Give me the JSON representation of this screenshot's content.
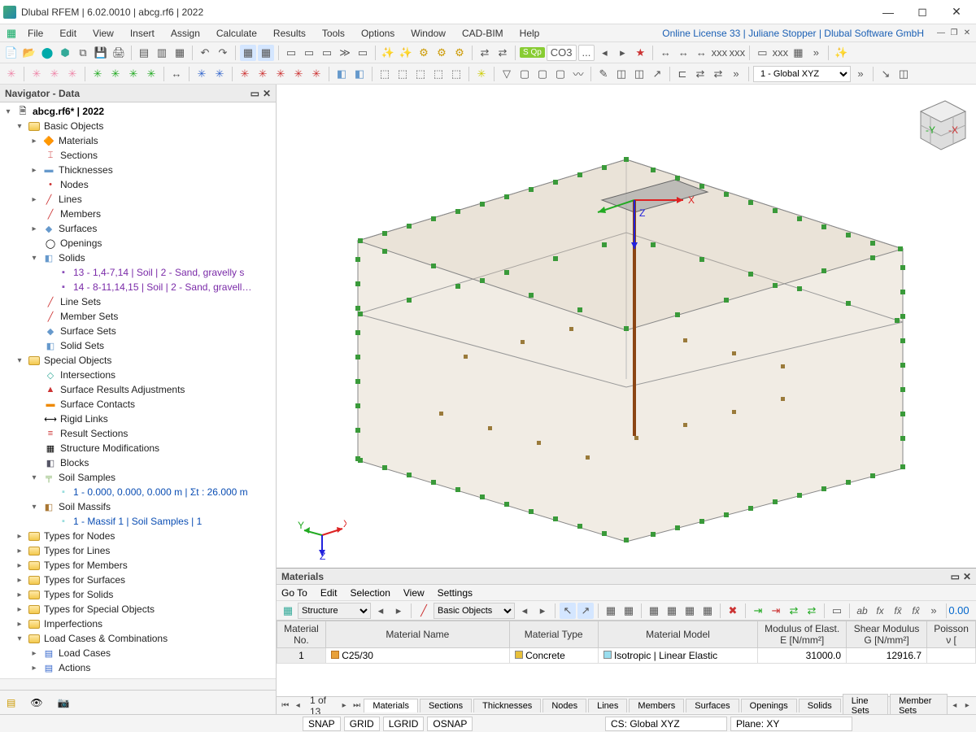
{
  "window": {
    "title": "Dlubal RFEM | 6.02.0010 | abcg.rf6 | 2022"
  },
  "license": "Online License 33 | Juliane Stopper | Dlubal Software GmbH",
  "menu": [
    "File",
    "Edit",
    "View",
    "Insert",
    "Assign",
    "Calculate",
    "Results",
    "Tools",
    "Options",
    "Window",
    "CAD-BIM",
    "Help"
  ],
  "toolbar2": {
    "badge": "S Qp",
    "combo": "CO3",
    "combo_dots": "..."
  },
  "toolbar3": {
    "coord_system": "1 - Global XYZ"
  },
  "navigator": {
    "title": "Navigator - Data",
    "root": "abcg.rf6* | 2022",
    "basic_objects": "Basic Objects",
    "items": {
      "materials": "Materials",
      "sections": "Sections",
      "thicknesses": "Thicknesses",
      "nodes": "Nodes",
      "lines": "Lines",
      "members": "Members",
      "surfaces": "Surfaces",
      "openings": "Openings",
      "solids": "Solids",
      "solid_13": "13 - 1,4-7,14 | Soil | 2 - Sand, gravelly s",
      "solid_14": "14 - 8-11,14,15 | Soil | 2 - Sand, gravell…",
      "line_sets": "Line Sets",
      "member_sets": "Member Sets",
      "surface_sets": "Surface Sets",
      "solid_sets": "Solid Sets"
    },
    "special_objects": "Special Objects",
    "special": {
      "intersections": "Intersections",
      "surface_results_adj": "Surface Results Adjustments",
      "surface_contacts": "Surface Contacts",
      "rigid_links": "Rigid Links",
      "result_sections": "Result Sections",
      "structure_mods": "Structure Modifications",
      "blocks": "Blocks",
      "soil_samples": "Soil Samples",
      "soil_sample_1": "1 - 0.000, 0.000, 0.000 m | Σt : 26.000 m",
      "soil_massifs": "Soil Massifs",
      "soil_massif_1": "1 - Massif 1 | Soil Samples | 1"
    },
    "types": {
      "nodes": "Types for Nodes",
      "lines": "Types for Lines",
      "members": "Types for Members",
      "surfaces": "Types for Surfaces",
      "solids": "Types for Solids",
      "special": "Types for Special Objects",
      "imperfections": "Imperfections",
      "load_cases": "Load Cases & Combinations",
      "lc": "Load Cases",
      "actions": "Actions"
    }
  },
  "materials": {
    "title": "Materials",
    "menu": [
      "Go To",
      "Edit",
      "Selection",
      "View",
      "Settings"
    ],
    "structure_select": "Structure",
    "basic_select": "Basic Objects",
    "headers": [
      "Material No.",
      "Material Name",
      "Material Type",
      "Material Model",
      "Modulus of Elast. E [N/mm²]",
      "Shear Modulus G [N/mm²]",
      "Poisson ν ["
    ],
    "row1": {
      "no": "1",
      "name": "C25/30",
      "type": "Concrete",
      "model": "Isotropic | Linear Elastic",
      "E": "31000.0",
      "G": "12916.7"
    },
    "page": "1 of 13",
    "tabs": [
      "Materials",
      "Sections",
      "Thicknesses",
      "Nodes",
      "Lines",
      "Members",
      "Surfaces",
      "Openings",
      "Solids",
      "Line Sets",
      "Member Sets"
    ]
  },
  "status": {
    "snap": "SNAP",
    "grid": "GRID",
    "lgrid": "LGRID",
    "osnap": "OSNAP",
    "cs": "CS: Global XYZ",
    "plane": "Plane: XY"
  },
  "axes": {
    "x": "X",
    "y": "Y",
    "z": "Z"
  },
  "cube": {
    "y": "-Y",
    "x": "-X"
  }
}
